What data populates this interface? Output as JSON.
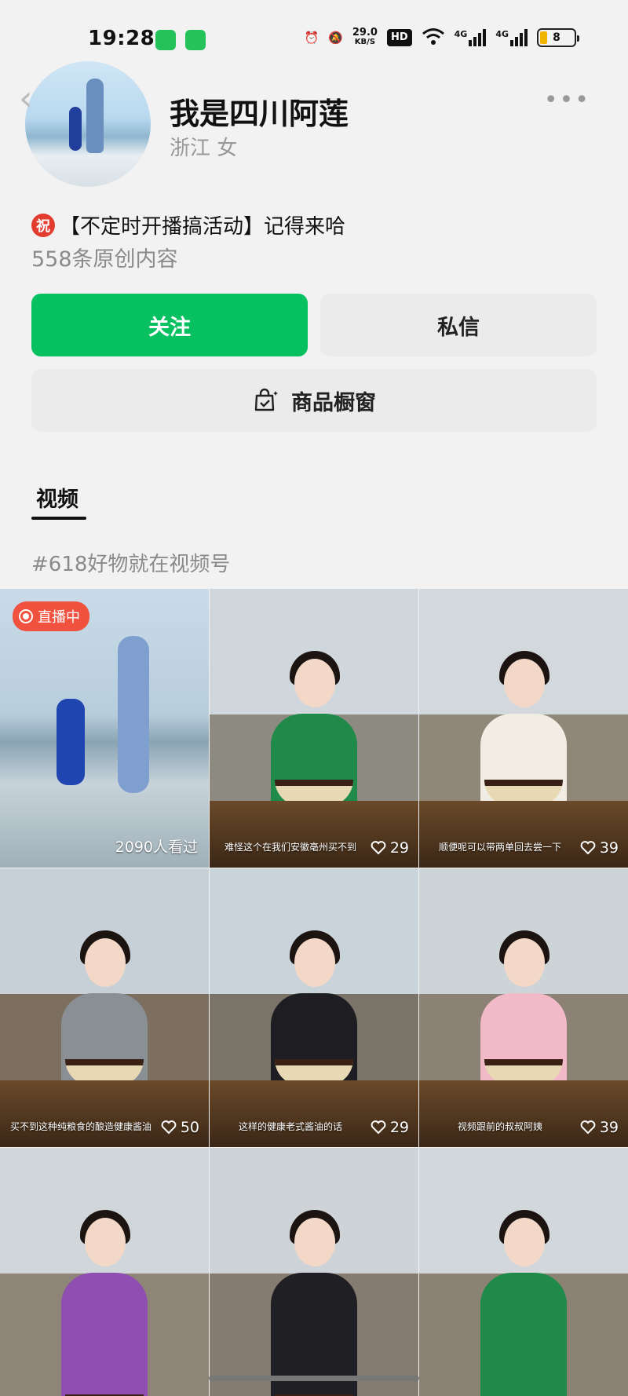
{
  "status_bar": {
    "time": "19:28",
    "net_speed_value": "29.0",
    "net_speed_unit": "KB/S",
    "hd_label": "HD",
    "sim1": "4G",
    "sim2": "4G",
    "battery": "8",
    "icons": [
      "battery-saver-icon",
      "chat-app-icon",
      "alarm-icon",
      "mute-icon",
      "wifi-icon",
      "signal-icon"
    ]
  },
  "profile": {
    "name": "我是四川阿莲",
    "location_gender": "浙江 女",
    "bio_badge": "祝",
    "bio": "【不定时开播搞活动】记得来哈",
    "original_count": "558条原创内容"
  },
  "actions": {
    "follow": "关注",
    "message": "私信",
    "shop": "商品橱窗"
  },
  "tabs": {
    "videos": "视频"
  },
  "topic": "#618好物就在视频号",
  "videos": [
    {
      "live": "直播中",
      "views": "2090人看过"
    },
    {
      "caption": "难怪这个在我们安徽亳州买不到",
      "likes": "29"
    },
    {
      "caption": "顺便呢可以带两单回去尝一下",
      "likes": "39"
    },
    {
      "caption": "买不到这种纯粮食的酿造健康酱油",
      "likes": "50"
    },
    {
      "caption": "这样的健康老式酱油的话",
      "likes": "29"
    },
    {
      "caption": "视频跟前的叔叔阿姨",
      "likes": "39"
    },
    {},
    {},
    {}
  ],
  "colors": {
    "accent_green": "#07c160",
    "live_red": "#f0523f"
  }
}
